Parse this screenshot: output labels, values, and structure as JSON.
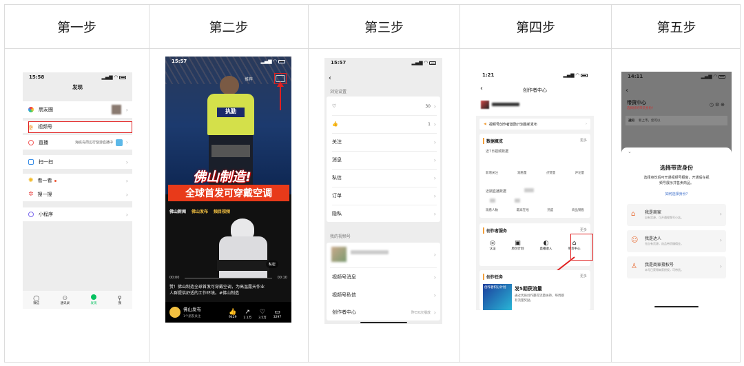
{
  "headers": [
    "第一步",
    "第二步",
    "第三步",
    "第四步",
    "第五步"
  ],
  "step1": {
    "time": "15:58",
    "title": "发现",
    "items": [
      {
        "label": "朋友圈",
        "icon": "moments-icon"
      },
      {
        "label": "视频号",
        "icon": "channels-icon"
      },
      {
        "label": "直播",
        "icon": "live-icon",
        "extra": "海底岛周边行悠游直播中"
      },
      {
        "label": "扫一扫",
        "icon": "scan-icon"
      },
      {
        "label": "看一看",
        "icon": "look-icon"
      },
      {
        "label": "搜一搜",
        "icon": "search-icon"
      },
      {
        "label": "小程序",
        "icon": "miniprogram-icon"
      }
    ],
    "tabs": [
      "微信",
      "通讯录",
      "发现",
      "我"
    ]
  },
  "step2": {
    "time": "15:57",
    "tab_label": "推荐",
    "badge_text": "执勤",
    "headline1": "佛山制造!",
    "headline2": "全球首发可穿戴空调",
    "sources": [
      "佛山新闻",
      "佛山发布",
      "頻目视频"
    ],
    "time_start": "00:00",
    "time_end": "00:10",
    "caption1": "赞！佛山制造全球首发可穿戴空调，为高温露天作业",
    "caption2": "人群提供舒适的工作环境。#佛山制造",
    "account": "佛山发布",
    "account_sub": "1个朋友关注",
    "counts": [
      "9429",
      "2.1万",
      "3.5万",
      "3297"
    ],
    "float_label": "私密"
  },
  "step3": {
    "time": "15:57",
    "section1": "浏览设置",
    "items": [
      {
        "label": "♡",
        "value": "30"
      },
      {
        "label": "👍",
        "value": "1"
      },
      {
        "label": "关注",
        "value": ""
      },
      {
        "label": "消息",
        "value": ""
      },
      {
        "label": "私信",
        "value": ""
      },
      {
        "label": "订单",
        "value": ""
      },
      {
        "label": "隐私",
        "value": ""
      }
    ],
    "section2": "我的视频号",
    "items2": [
      {
        "label": "视频号消息"
      },
      {
        "label": "视频号私信"
      },
      {
        "label": "创作者中心",
        "value": "昨日0次播放"
      }
    ]
  },
  "step4": {
    "time": "1:21",
    "title": "创作者中心",
    "notice": "视频号创作者激励计划最新发布",
    "overview_title": "数据概览",
    "more": "更多",
    "week_label": "近7日视频数据",
    "stats1": [
      "新增关注",
      "观看量",
      "点赞量",
      "评论量"
    ],
    "live_label": "近期直播数据",
    "stats2": [
      "观看人数",
      "最高在线",
      "热度",
      "商品销售"
    ],
    "services_title": "创作者服务",
    "services": [
      "认证",
      "原创计划",
      "直播收入",
      "带货中心"
    ],
    "tasks_title": "创作任务",
    "task_banner": "创作者积分计划",
    "task_name": "发5期获流量",
    "task_desc1": "通过优质创作赢得流量扶持，每周都",
    "task_desc2": "有流量奖励。"
  },
  "step5": {
    "time": "14:11",
    "title": "带货中心",
    "subtitle": "选择好的带货身份！",
    "notice": "通知",
    "notice_text": "新上市，您可以",
    "sheet_title": "选择带货身份",
    "sheet_desc1": "选择身份后可开通视频号橱窗，开通后在视",
    "sheet_desc2": "频号展示并售卖商品。",
    "link": "如何选择身份?",
    "options": [
      {
        "title": "我是商家",
        "desc": "自有货源，可开通视频号小店。"
      },
      {
        "title": "我是达人",
        "desc": "无自有货源，选品带货赚佣金。"
      },
      {
        "title": "我是商家授权号",
        "desc": "本号已获得商家授权，可带货。"
      }
    ]
  }
}
